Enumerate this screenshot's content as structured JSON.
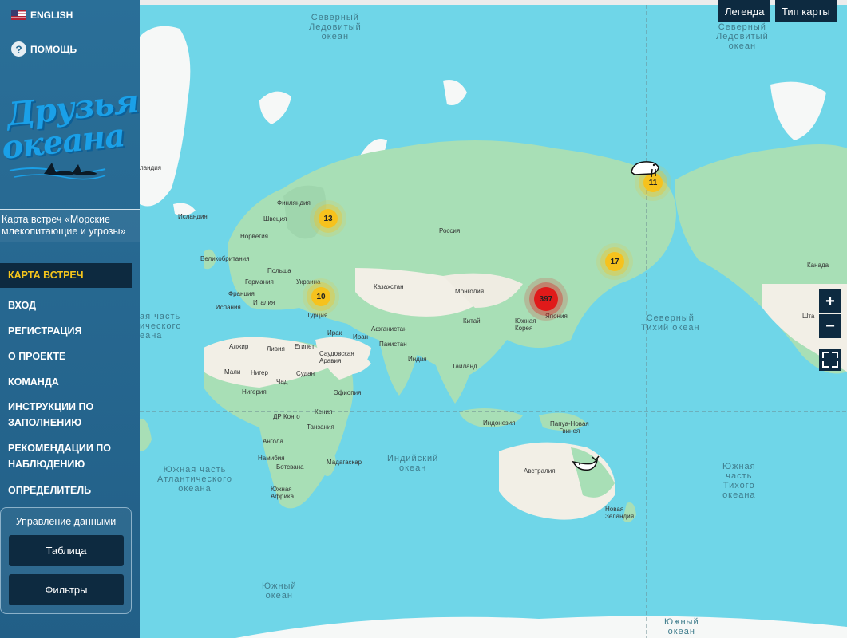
{
  "sidebar": {
    "language_label": "ENGLISH",
    "help_label": "ПОМОЩЬ",
    "logo_line1": "Друзья",
    "logo_line2": "океана",
    "project_title": "Карта встреч «Морские млекопитающие и угрозы»",
    "menu": [
      {
        "label": "КАРТА ВСТРЕЧ",
        "active": true
      },
      {
        "label": "ВХОД"
      },
      {
        "label": "РЕГИСТРАЦИЯ"
      },
      {
        "label": "О ПРОЕКТЕ"
      },
      {
        "label": "КОМАНДА"
      },
      {
        "label": "ИНСТРУКЦИИ ПО ЗАПОЛНЕНИЮ"
      },
      {
        "label": "РЕКОМЕНДАЦИИ ПО НАБЛЮДЕНИЮ"
      },
      {
        "label": "ОПРЕДЕЛИТЕЛЬ"
      }
    ],
    "data_panel": {
      "title": "Управление данными",
      "table_button": "Таблица",
      "filters_button": "Фильтры"
    }
  },
  "map": {
    "legend_button": "Легенда",
    "map_type_button": "Тип карты",
    "zoom_in": "+",
    "zoom_out": "−",
    "oceans": {
      "arctic_left": "Северный\nЛедовитый\nокеан",
      "arctic_right": "Северный\nЛедовитый\nокеан",
      "north_pacific": "Северный\nТихий океан",
      "north_atlantic_partial": "ая часть\nического\nеана",
      "south_atlantic": "Южная часть\nАтлантического\nокеана",
      "indian": "Индийский\nокеан",
      "south_pacific": "Южная\nчасть\nТихого\nокеана",
      "southern_left": "Южный\nокеан",
      "southern_right": "Южный\nокеан"
    },
    "places": {
      "greenland": "ландия",
      "iceland": "Исландия",
      "finland": "Финляндия",
      "sweden": "Швеция",
      "norway": "Норвегия",
      "uk": "Великобритания",
      "poland": "Польша",
      "germany": "Германия",
      "ukraine": "Украина",
      "france": "Франция",
      "italy": "Италия",
      "spain": "Испания",
      "turkey": "Турция",
      "russia": "Россия",
      "kazakhstan": "Казахстан",
      "mongolia": "Монголия",
      "china": "Китай",
      "south_korea": "Южная\nКорея",
      "japan": "Япония",
      "iraq": "Ирак",
      "iran": "Иран",
      "afghanistan": "Афганистан",
      "pakistan": "Пакистан",
      "india": "Индия",
      "thailand": "Таиланд",
      "saudi": "Саудовская\nАравия",
      "egypt": "Египет",
      "libya": "Ливия",
      "algeria": "Алжир",
      "mali": "Мали",
      "niger": "Нигер",
      "chad": "Чад",
      "sudan": "Судан",
      "nigeria": "Нигерия",
      "ethiopia": "Эфиопия",
      "kenya": "Кения",
      "drc": "ДР Конго",
      "tanzania": "Танзания",
      "angola": "Ангола",
      "namibia": "Намибия",
      "botswana": "Ботсвана",
      "madagascar": "Мадагаскар",
      "south_africa": "Южная\nАфрика",
      "indonesia": "Индонезия",
      "png": "Папуа-Новая\nГвинея",
      "australia": "Австралия",
      "new_zealand": "Новая\nЗеландия",
      "canada": "Канада",
      "usa_partial": "Шта"
    },
    "clusters": [
      {
        "count": "13",
        "color": "yellow"
      },
      {
        "count": "10",
        "color": "yellow"
      },
      {
        "count": "397",
        "color": "red"
      },
      {
        "count": "17",
        "color": "yellow"
      },
      {
        "count": "11",
        "color": "yellow"
      }
    ]
  },
  "colors": {
    "sidebar": "#2a6f98",
    "dark_button": "#0d2a40",
    "active_text": "#f5c51b",
    "ocean": "#6fd6e8",
    "land": "#a8dfb6",
    "desert": "#f2efe6",
    "cluster_yellow": "#f6c21d",
    "cluster_red": "#e01a1a"
  }
}
